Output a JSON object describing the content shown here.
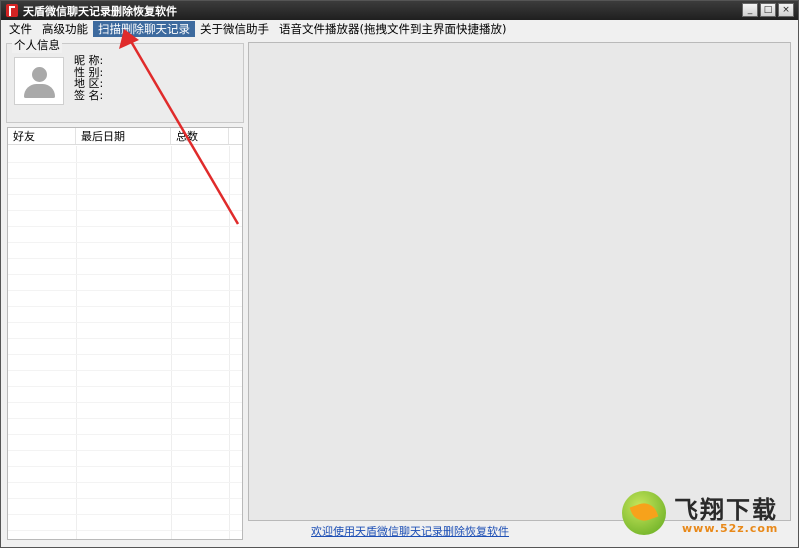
{
  "window": {
    "title": "天盾微信聊天记录删除恢复软件",
    "controls": {
      "minimize": "_",
      "maximize": "□",
      "close": "×"
    }
  },
  "menu": {
    "items": [
      {
        "label": "文件"
      },
      {
        "label": "高级功能"
      },
      {
        "label": "扫描删除聊天记录"
      },
      {
        "label": "关于微信助手"
      },
      {
        "label": "语音文件播放器(拖拽文件到主界面快捷播放)"
      }
    ],
    "active_index": 2
  },
  "profile": {
    "legend": "个人信息",
    "fields": {
      "nickname": "昵  称:",
      "gender": "性  别:",
      "region": "地  区:",
      "signature": "签  名:"
    }
  },
  "friends_table": {
    "columns": [
      "好友",
      "最后日期",
      "总数",
      ""
    ]
  },
  "footer": {
    "welcome_link": "欢迎使用天盾微信聊天记录删除恢复软件"
  },
  "watermark": {
    "title": "飞翔下载",
    "url": "www.52z.com"
  },
  "colors": {
    "titlebar": "#2b2b2b",
    "menu_active": "#3d6a9e",
    "link": "#1d4fb5",
    "arrow": "#e02b2b",
    "app_icon": "#d42424"
  }
}
